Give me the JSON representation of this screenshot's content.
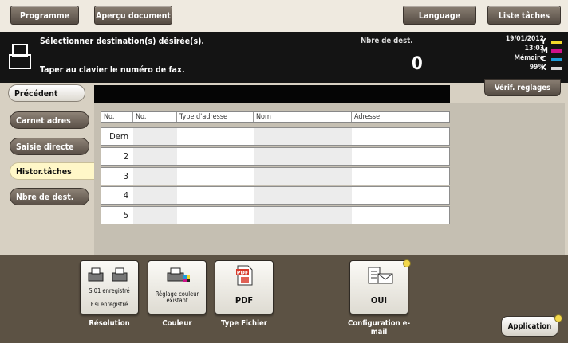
{
  "top_tabs": {
    "programme": "Programme",
    "apercu": "Aperçu document",
    "language": "Language",
    "liste_taches": "Liste tâches"
  },
  "header": {
    "instruction": "Sélectionner destination(s) désirée(s).",
    "subinstruction": "Taper au clavier le numéro de fax.",
    "count_label": "Nbre de dest.",
    "count_value": "0",
    "date": "19/01/2012",
    "time": "13:03",
    "memory_label": "Mémoire",
    "memory_value": "99%",
    "toner": [
      {
        "letter": "Y",
        "color": "#f3d82a"
      },
      {
        "letter": "M",
        "color": "#d0108a"
      },
      {
        "letter": "C",
        "color": "#1e9bd7"
      },
      {
        "letter": "K",
        "color": "#d8d8d8"
      }
    ]
  },
  "verif_label": "Vérif. réglages",
  "nav": {
    "precedent": "Précédent",
    "carnet": "Carnet adres",
    "saisie": "Saisie directe",
    "histor": "Histor.tâches",
    "nbre": "Nbre de dest."
  },
  "table": {
    "headers": [
      "No.",
      "No.",
      "Type d'adresse",
      "Nom",
      "Adresse"
    ],
    "rows": [
      "Dern",
      "2",
      "3",
      "4",
      "5"
    ]
  },
  "functions": {
    "resolution": {
      "label": "Résolution",
      "text1": "S.01 enregistré",
      "text2": "F.si enregistré"
    },
    "couleur": {
      "label": "Couleur",
      "text": "Réglage couleur existant"
    },
    "type_fichier": {
      "label": "Type Fichier",
      "value": "PDF",
      "icon_text": "PDF"
    },
    "email": {
      "label": "Configuration e-mail",
      "value": "OUI"
    }
  },
  "application_label": "Application",
  "colors": {
    "header_bg": "#141414",
    "panel_bg": "#d7d0c2",
    "bottom_bg": "#5c5244",
    "selected_tab": "#fff7c8"
  }
}
